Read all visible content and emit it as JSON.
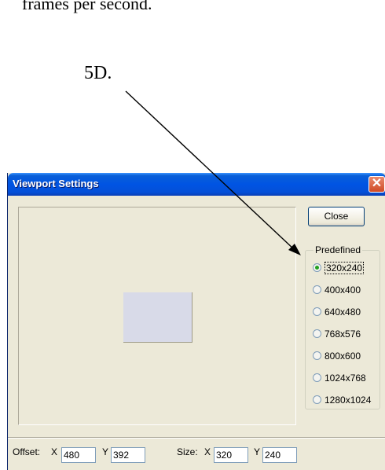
{
  "document": {
    "top_text": "frames per second.",
    "callout_label": "5D."
  },
  "window": {
    "title": "Viewport Settings",
    "close_glyph": "✕",
    "close_button_label": "Close",
    "predefined_label": "Predefined",
    "radio_options": [
      "320x240",
      "400x400",
      "640x480",
      "768x576",
      "800x600",
      "1024x768",
      "1280x1024"
    ],
    "selected_option": "320x240",
    "offset": {
      "label": "Offset:",
      "x_label": "X",
      "x_value": "480",
      "y_label": "Y",
      "y_value": "392"
    },
    "size": {
      "label": "Size:",
      "x_label": "X",
      "x_value": "320",
      "y_label": "Y",
      "y_value": "240"
    }
  },
  "colors": {
    "titlebar": "#0054e3",
    "window_face": "#ece9d8",
    "viewport_rect": "#d8dae8",
    "close_x": "#d04a24"
  }
}
